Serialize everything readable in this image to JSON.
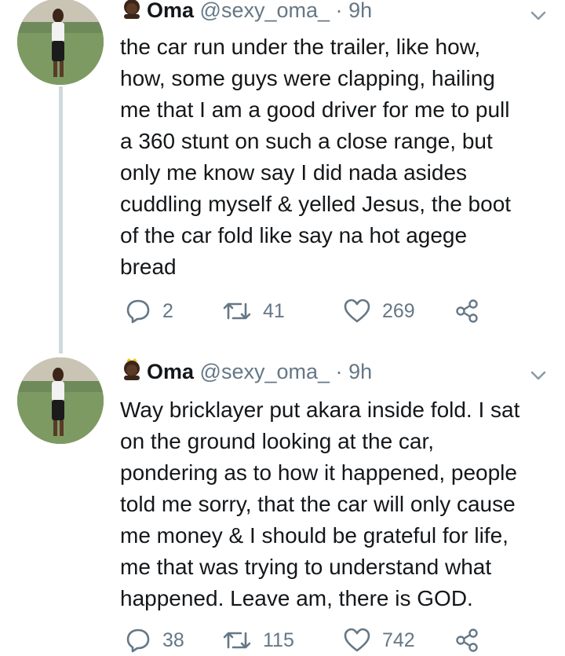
{
  "tweets": [
    {
      "display_name": "Oma",
      "handle": "@sexy_oma_",
      "separator": "·",
      "time": "9h",
      "text_lines": [
        "the car run under the trailer, like how,",
        "how, some guys were clapping, hailing",
        "me that I am a good driver for me to pull",
        "a 360 stunt on such a close range, but",
        "only me know say I did nada asides",
        "cuddling myself & yelled Jesus, the boot",
        "of the car fold like say na hot agege",
        "bread"
      ],
      "replies": "2",
      "retweets": "41",
      "likes": "269"
    },
    {
      "display_name": "Oma",
      "handle": "@sexy_oma_",
      "separator": "·",
      "time": "9h",
      "text_lines": [
        "Way bricklayer put akara inside fold. I sat",
        "on the ground looking at the car,",
        "pondering as to how it happened, people",
        "told me sorry, that the car will only cause",
        "me money & I should be grateful for life,",
        "me that was trying to understand what",
        "happened. Leave am, there is GOD."
      ],
      "replies": "38",
      "retweets": "115",
      "likes": "742"
    }
  ],
  "colors": {
    "text": "#14171a",
    "muted": "#657786",
    "thread_line": "#cfd9de",
    "background": "#ffffff"
  },
  "icons": {
    "name_emoji": "princess-emoji-icon",
    "menu": "chevron-down-icon",
    "reply": "reply-icon",
    "retweet": "retweet-icon",
    "like": "heart-icon",
    "share": "share-icon"
  }
}
